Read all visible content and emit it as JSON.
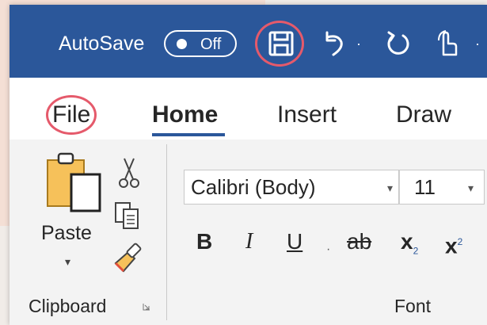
{
  "titlebar": {
    "autosave_label": "AutoSave",
    "autosave_state": "Off",
    "icons": {
      "save": "save-icon",
      "undo": "undo-icon",
      "redo": "redo-icon",
      "touch": "touch-mode-icon"
    },
    "dropdown_glyph": "·",
    "highlight_color": "#e55a6b",
    "bar_color": "#2b579a"
  },
  "tabs": [
    {
      "label": "File"
    },
    {
      "label": "Home",
      "active": true
    },
    {
      "label": "Insert"
    },
    {
      "label": "Draw"
    }
  ],
  "clipboard": {
    "paste_label": "Paste",
    "paste_dropdown": "▾",
    "group_label": "Clipboard",
    "icons": [
      "paste-icon",
      "cut-icon",
      "copy-icon",
      "format-painter-icon"
    ]
  },
  "font": {
    "font_name": "Calibri (Body)",
    "font_size": "11",
    "dropdown_arrow": "▾",
    "bold": "B",
    "italic": "I",
    "underline": "U",
    "strikethrough": "ab",
    "subscript_base": "x",
    "subscript_mark": "2",
    "superscript_base": "x",
    "superscript_mark": "2",
    "group_label": "Font"
  }
}
